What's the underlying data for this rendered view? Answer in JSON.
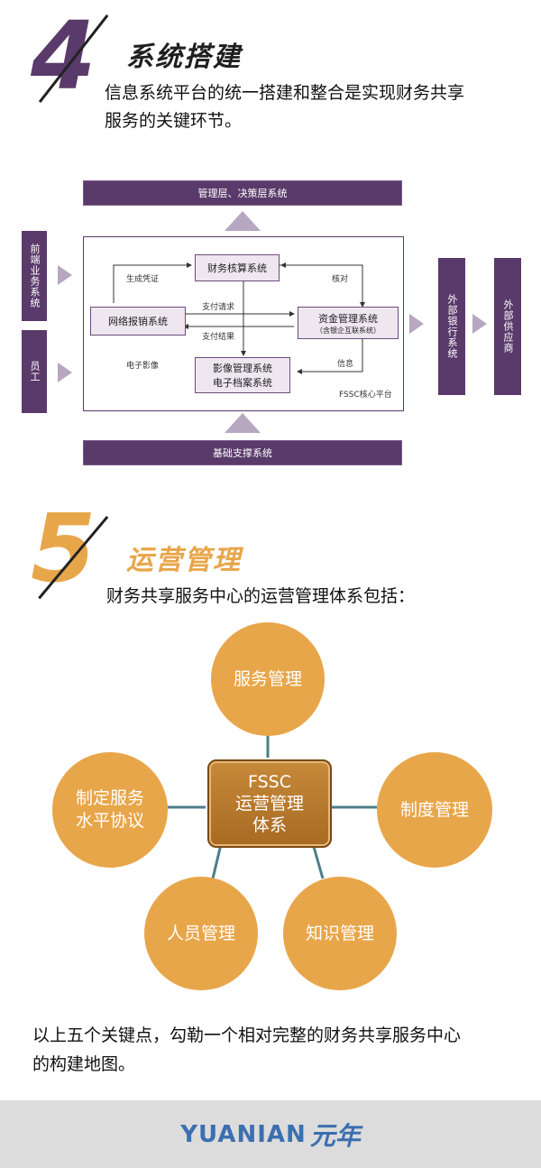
{
  "section4": {
    "number": "4",
    "title": "系统搭建",
    "intro_line1": "信息系统平台的统一搭建和整合是实现财务共享",
    "intro_line2": "服务的关键环节。",
    "color": "#5a3a6a",
    "diagram": {
      "top_bar": "管理层、决策层系统",
      "bottom_bar": "基础支撑系统",
      "left_top": "前端业务系统",
      "left_bottom": "员工",
      "right_1": "外部银行系统",
      "right_2": "外部供应商",
      "node_accounting": "财务核算系统",
      "node_reimburse": "网络报销系统",
      "node_funds": "资金管理系统",
      "node_funds_sub": "（含银企互联系统）",
      "node_image_line1": "影像管理系统",
      "node_image_line2": "电子档案系统",
      "label_voucher": "生成凭证",
      "label_reconcile": "核对",
      "label_pay_request": "支付请求",
      "label_pay_result": "支付结果",
      "label_e_image": "电子影像",
      "label_info": "信息",
      "platform_label": "FSSC核心平台"
    }
  },
  "section5": {
    "number": "5",
    "title": "运营管理",
    "intro": "财务共享服务中心的运营管理体系包括：",
    "color": "#e8a64a",
    "center_line1": "FSSC",
    "center_line2": "运营管理",
    "center_line3": "体系",
    "circle_top": "服务管理",
    "circle_left_line1": "制定服务",
    "circle_left_line2": "水平协议",
    "circle_right": "制度管理",
    "circle_bottom_left": "人员管理",
    "circle_bottom_right": "知识管理"
  },
  "closing_line1": "以上五个关键点，勾勒一个相对完整的财务共享服务中心",
  "closing_line2": "的构建地图。",
  "footer": {
    "brand_en": "YUANIAN",
    "brand_cn": "元年"
  }
}
